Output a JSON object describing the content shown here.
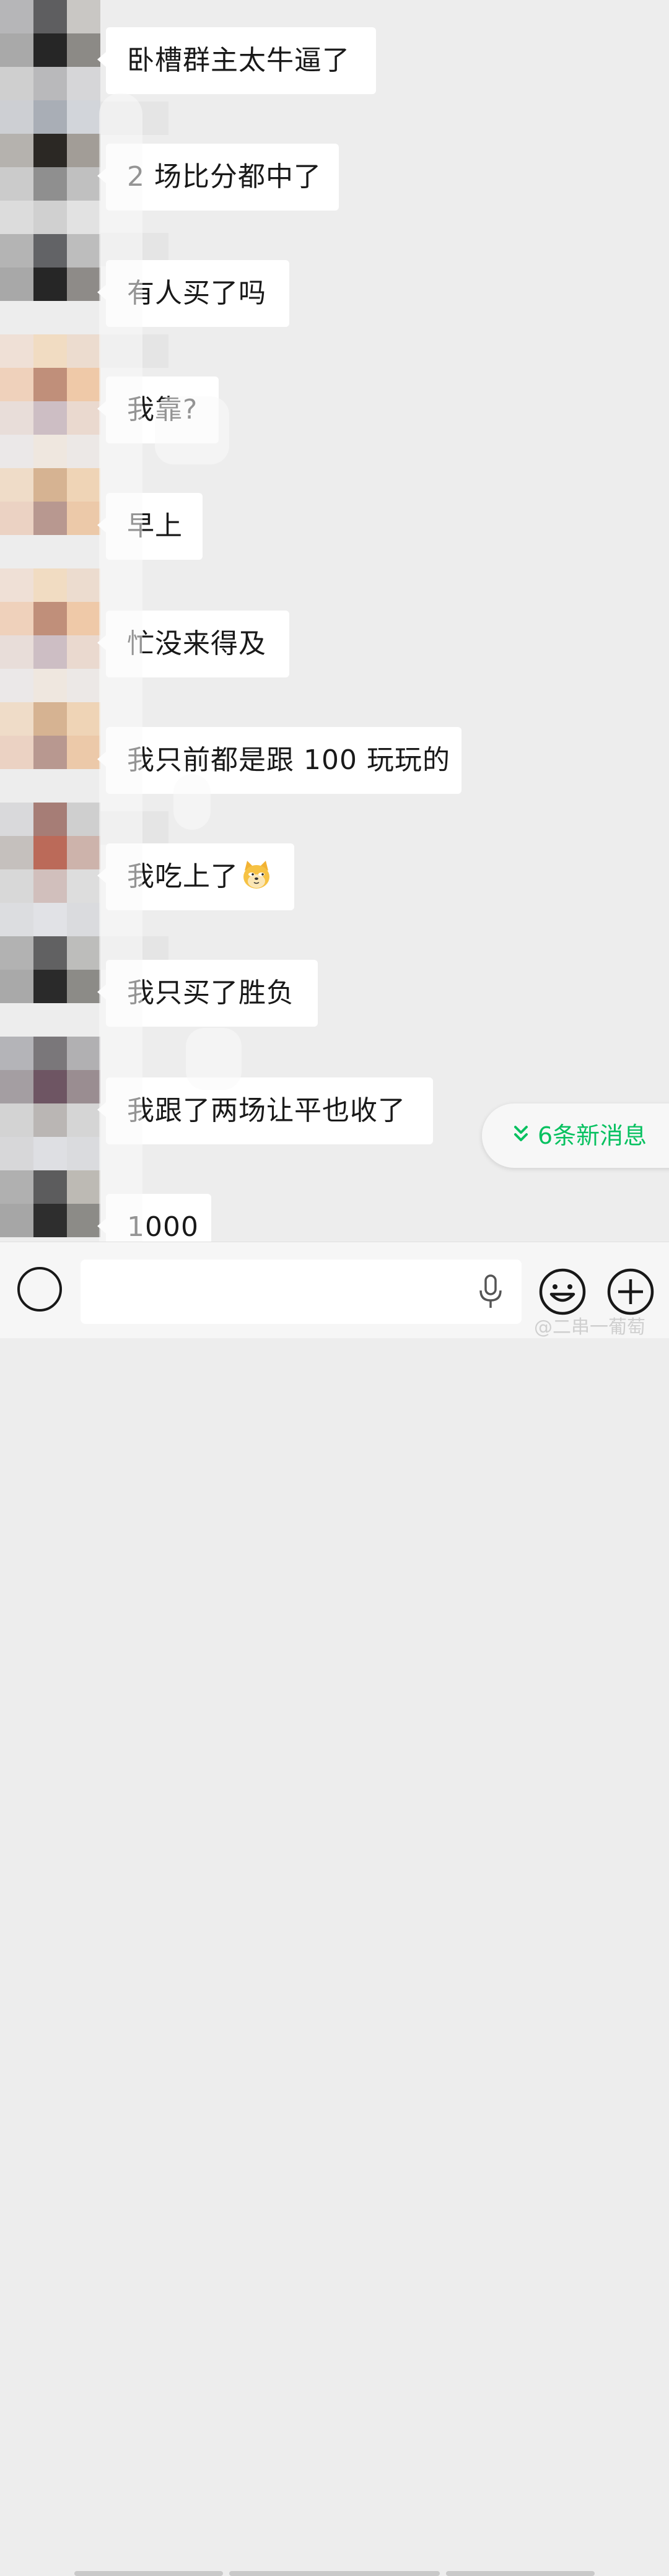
{
  "messages": [
    {
      "text": "卧槽群主太牛逼了"
    },
    {
      "text": "2 场比分都中了"
    },
    {
      "text": "有人买了吗"
    },
    {
      "text": "我靠?"
    },
    {
      "text": "早上"
    },
    {
      "text": "忙没来得及"
    },
    {
      "text": "我只前都是跟 100 玩玩的"
    },
    {
      "text": "我吃上了",
      "emoji": "dog-doge-emoji"
    },
    {
      "text": "我只买了胜负"
    },
    {
      "text": "我跟了两场让平也收了"
    },
    {
      "text": "1000"
    }
  ],
  "new_messages": {
    "label": "6条新消息",
    "icon": "double-chevron-down-icon"
  },
  "input_bar": {
    "placeholder": "",
    "icons": [
      "voice-icon",
      "microphone-icon",
      "emoji-face-icon",
      "plus-icon"
    ]
  },
  "watermark": "@二串一葡萄",
  "colors": {
    "background": "#ededed",
    "bubble": "#ffffff",
    "accent": "#07c160",
    "text": "#191919"
  }
}
